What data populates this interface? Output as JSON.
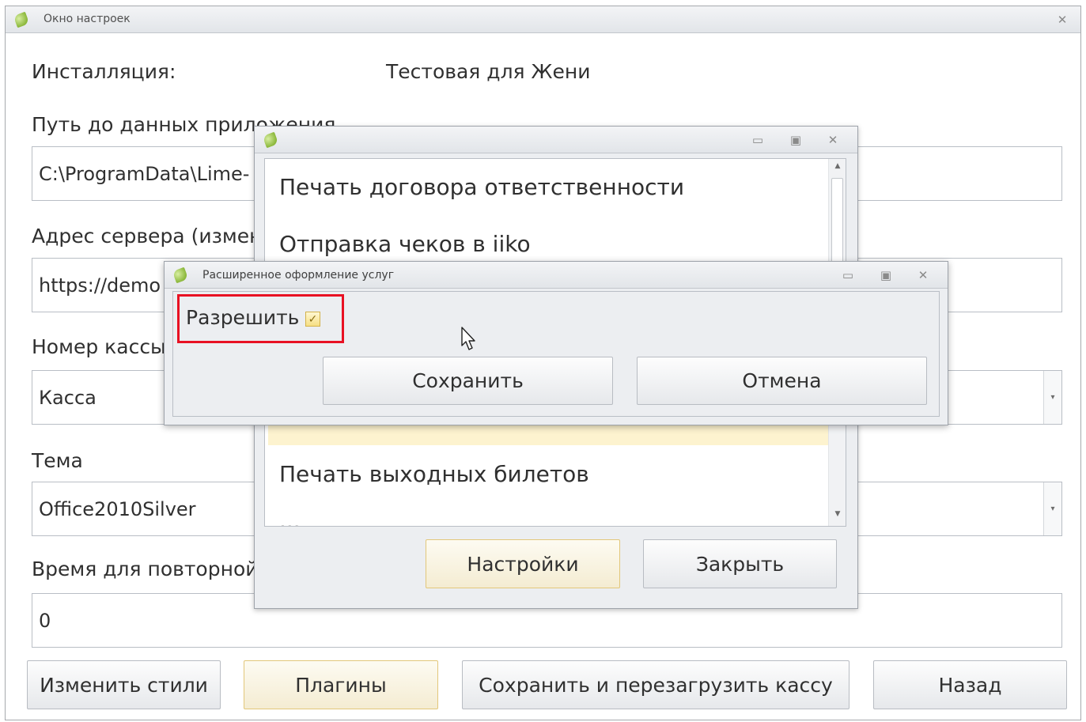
{
  "main_window": {
    "title": "Окно настроек",
    "close_glyph": "✕",
    "installation_label": "Инсталляция:",
    "installation_value": "Тестовая для Жени",
    "app_data_path_label": "Путь до данных приложения",
    "app_data_path_value": "C:\\ProgramData\\Lime-",
    "server_address_label": "Адрес сервера (измен",
    "server_address_value": "https://demo",
    "cash_number_label": "Номер кассы",
    "cash_number_value": "Касса",
    "theme_label": "Тема",
    "theme_value": "Office2010Silver",
    "retry_time_label": "Время для повторной",
    "retry_time_value": "0",
    "buttons": {
      "change_styles": "Изменить стили",
      "plugins": "Плагины",
      "save_restart": "Сохранить и перезагрузить кассу",
      "back": "Назад"
    }
  },
  "plugins_window": {
    "items": [
      "Печать договора ответственности",
      "Отправка чеков в iiko",
      "Печать выходных билетов",
      "..."
    ],
    "buttons": {
      "settings": "Настройки",
      "close": "Закрыть"
    },
    "controls": {
      "minimize": "▭",
      "maximize": "▣",
      "close": "✕"
    }
  },
  "ext_dialog": {
    "title": "Расширенное оформление услуг",
    "allow_label": "Разрешить",
    "allow_checked": true,
    "check_glyph": "✓",
    "buttons": {
      "save": "Сохранить",
      "cancel": "Отмена"
    },
    "controls": {
      "minimize": "▭",
      "maximize": "▣",
      "close": "✕"
    }
  },
  "icons": {
    "app_icon": "lime-leaf-icon",
    "combo_arrow": "▾",
    "scroll_up": "▲",
    "scroll_down": "▼",
    "cursor": "mouse-cursor-icon"
  },
  "colors": {
    "highlight_border": "#e81123",
    "selected_item": "#fdf3cf",
    "focus_button_border": "#e2c77a"
  }
}
